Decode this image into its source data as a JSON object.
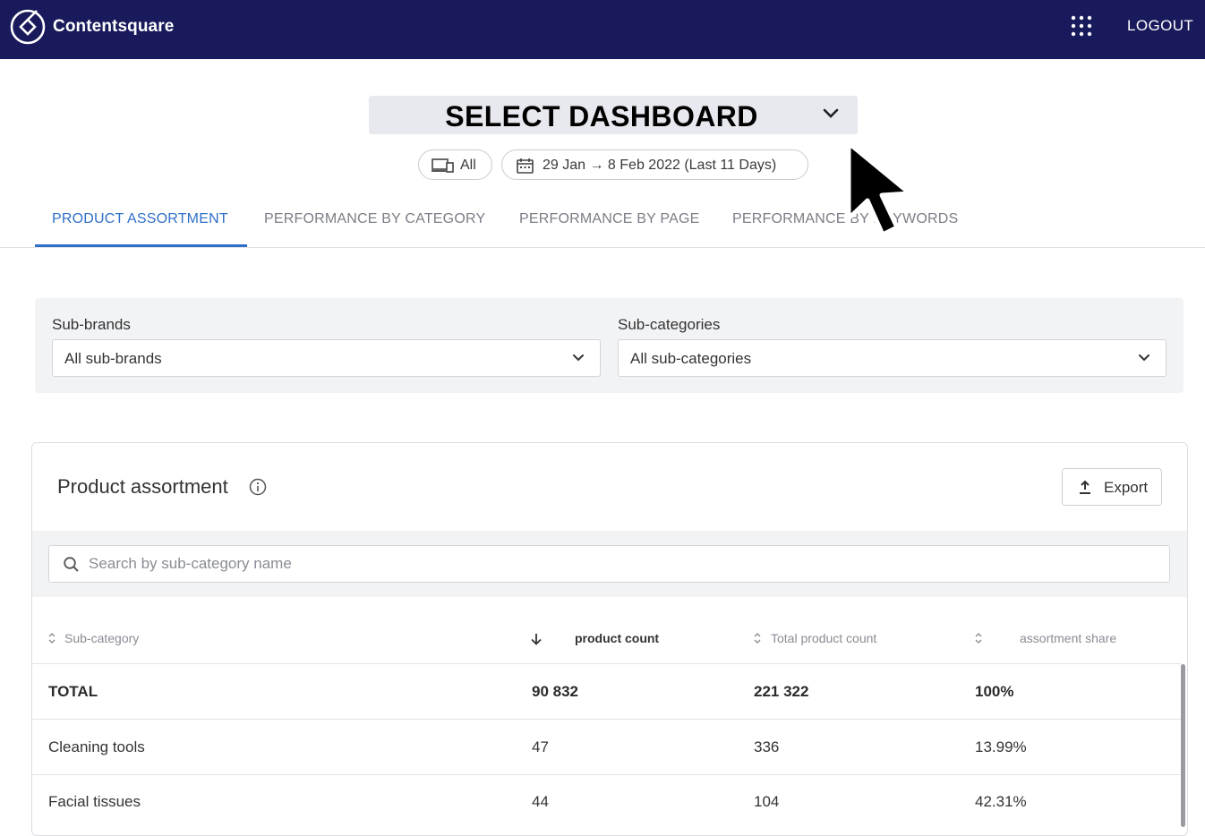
{
  "header": {
    "brand": "Contentsquare",
    "logout_label": "LOGOUT",
    "icons": {
      "logo": "contentsquare-logo-icon",
      "apps": "apps-grid-icon"
    },
    "background_color": "#191a5b"
  },
  "dashboard": {
    "select_label": "SELECT DASHBOARD"
  },
  "filters_bar": {
    "device_label": "All",
    "date_range": "29 Jan → 8 Feb 2022 (Last 11 Days)"
  },
  "tabs": [
    {
      "label": "PRODUCT ASSORTMENT",
      "active": true
    },
    {
      "label": "PERFORMANCE BY CATEGORY",
      "active": false
    },
    {
      "label": "PERFORMANCE BY PAGE",
      "active": false
    },
    {
      "label": "PERFORMANCE BY KEYWORDS",
      "active": false
    }
  ],
  "filters": {
    "sub_brands": {
      "label": "Sub-brands",
      "value": "All sub-brands"
    },
    "sub_categories": {
      "label": "Sub-categories",
      "value": "All sub-categories"
    }
  },
  "card": {
    "title": "Product assortment",
    "export_label": "Export",
    "search_placeholder": "Search by sub-category name"
  },
  "table": {
    "columns": [
      "Sub-category",
      "product count",
      "Total product count",
      "assortment share"
    ],
    "rows": [
      {
        "sub_category": "TOTAL",
        "product_count": "90 832",
        "total_product_count": "221 322",
        "assortment_share": "100%"
      },
      {
        "sub_category": "Cleaning tools",
        "product_count": "47",
        "total_product_count": "336",
        "assortment_share": "13.99%"
      },
      {
        "sub_category": "Facial tissues",
        "product_count": "44",
        "total_product_count": "104",
        "assortment_share": "42.31%"
      }
    ]
  },
  "colors": {
    "accent": "#2f6fc8",
    "header": "#191a5b"
  }
}
